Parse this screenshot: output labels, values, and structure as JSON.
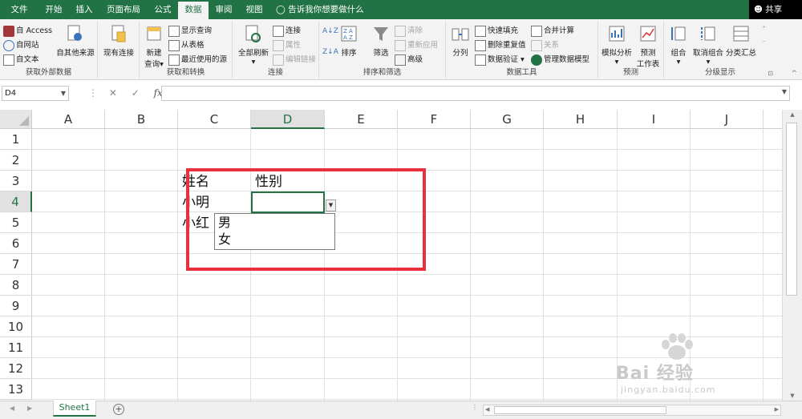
{
  "tabs": [
    "文件",
    "开始",
    "插入",
    "页面布局",
    "公式",
    "数据",
    "审阅",
    "视图"
  ],
  "active_tab": "数据",
  "tell_me": "告诉我你想要做什么",
  "share": "共享",
  "ribbon": {
    "get_external": {
      "label": "获取外部数据",
      "access": "自 Access",
      "web": "自网站",
      "text": "自文本",
      "other": "自其他来源",
      "existing": "现有连接"
    },
    "get_transform": {
      "label": "获取和转换",
      "new_query_1": "新建",
      "new_query_2": "查询",
      "show_queries": "显示查询",
      "from_table": "从表格",
      "recent_sources": "最近使用的源"
    },
    "connections": {
      "label": "连接",
      "refresh_all": "全部刷新",
      "connections": "连接",
      "properties": "属性",
      "edit_links": "编辑链接"
    },
    "sort_filter": {
      "label": "排序和筛选",
      "sort": "排序",
      "filter": "筛选",
      "clear": "清除",
      "reapply": "重新应用",
      "advanced": "高级"
    },
    "data_tools": {
      "label": "数据工具",
      "text_to_columns": "分列",
      "flash_fill": "快速填充",
      "remove_duplicates": "删除重复值",
      "data_validation": "数据验证",
      "consolidate": "合并计算",
      "relationships": "关系",
      "manage_model": "管理数据模型"
    },
    "forecast": {
      "label": "预测",
      "what_if": "模拟分析",
      "forecast_sheet_1": "预测",
      "forecast_sheet_2": "工作表"
    },
    "outline": {
      "label": "分级显示",
      "group": "组合",
      "ungroup": "取消组合",
      "subtotal": "分类汇总"
    }
  },
  "formula_bar": {
    "name_box": "D4",
    "formula": ""
  },
  "columns": [
    "A",
    "B",
    "C",
    "D",
    "E",
    "F",
    "G",
    "H",
    "I",
    "J"
  ],
  "rows": [
    "1",
    "2",
    "3",
    "4",
    "5",
    "6",
    "7",
    "8",
    "9",
    "10",
    "11",
    "12",
    "13"
  ],
  "cells": {
    "C3": "姓名",
    "D3": "性别",
    "C4": "小明",
    "C5": "小红"
  },
  "dropdown_options": [
    "男",
    "女"
  ],
  "sheets": [
    "Sheet1"
  ],
  "watermark": {
    "brand": "Bai 经验",
    "url": "jingyan.baidu.com"
  },
  "colors": {
    "excel_green": "#217346",
    "highlight_red": "#e8313c"
  }
}
